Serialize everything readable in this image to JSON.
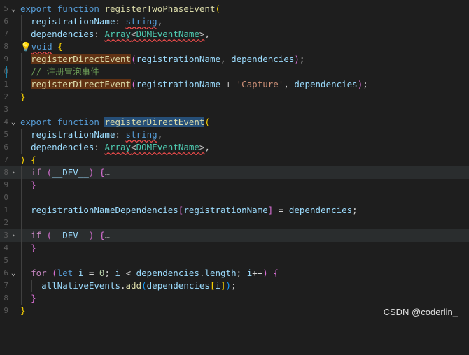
{
  "editor": {
    "gutter_numbers": [
      "5",
      "6",
      "7",
      "8",
      "9",
      "0",
      "1",
      "2",
      "3",
      "",
      "4",
      "5",
      "6",
      "7",
      "8",
      "9",
      "0",
      "1",
      "2",
      "3",
      "4",
      "5",
      "6",
      "7",
      "8",
      "9"
    ],
    "lines": [
      "export function registerTwoPhaseEvent(",
      "  registrationName: string,",
      "  dependencies: Array<DOMEventName>,",
      "  void {",
      "  registerDirectEvent(registrationName, dependencies);",
      "  // 注册冒泡事件",
      "  registerDirectEvent(registrationName + 'Capture', dependencies);",
      "}",
      "",
      "export function registerDirectEvent(",
      "  registrationName: string,",
      "  dependencies: Array<DOMEventName>,",
      ") {",
      "  if (__DEV__) {…",
      "  }",
      "",
      "  registrationNameDependencies[registrationName] = dependencies;",
      "",
      "  if (__DEV__) {…",
      "  }",
      "",
      "  for (let i = 0; i < dependencies.length; i++) {",
      "    allNativeEvents.add(dependencies[i]);",
      "  }",
      "}"
    ]
  },
  "tokens": {
    "export": "export",
    "function": "function",
    "fn_two_phase": "registerTwoPhaseEvent",
    "fn_direct": "registerDirectEvent",
    "registrationName": "registrationName",
    "dependencies": "dependencies",
    "string": "string",
    "Array": "Array",
    "DOMEventName": "DOMEventName",
    "void": "void",
    "comment": "// 注册冒泡事件",
    "capture_str": "'Capture'",
    "if": "if",
    "dev": "__DEV__",
    "ellipsis": "…",
    "regNameDeps": "registrationNameDependencies",
    "for": "for",
    "let": "let",
    "i": "i",
    "zero": "0",
    "length": "length",
    "allNativeEvents": "allNativeEvents",
    "add": "add"
  },
  "icons": {
    "lightbulb": "lightbulb-icon",
    "fold_open": "chevron-down-icon",
    "fold_closed": "chevron-right-icon"
  },
  "watermark": "CSDN @coderlin_"
}
